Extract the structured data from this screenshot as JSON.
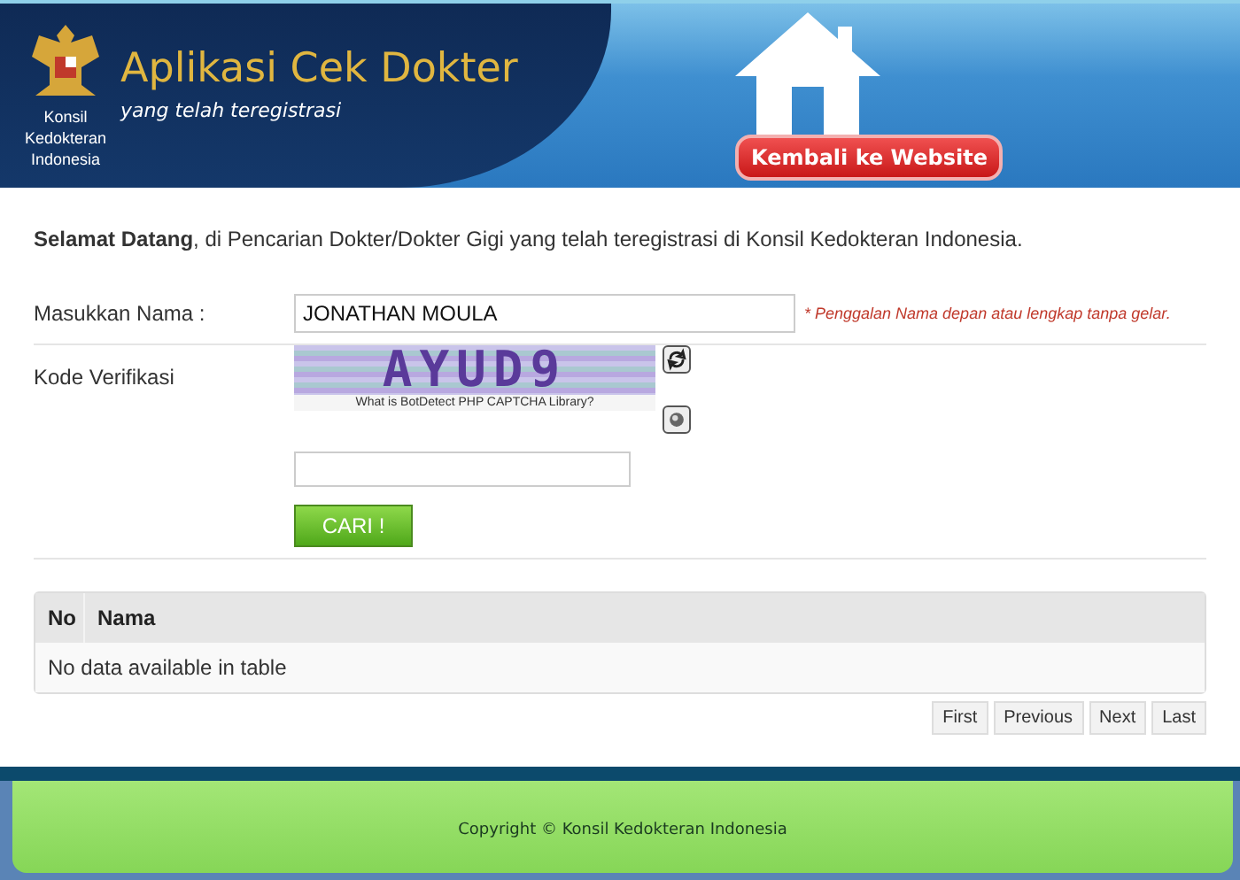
{
  "header": {
    "org_name": "Konsil Kedokteran Indonesia",
    "title": "Aplikasi Cek Dokter",
    "subtitle": "yang telah teregistrasi",
    "back_button": "Kembali ke Website"
  },
  "welcome": "**Selamat Datang**, di Pencarian Dokter/Dokter Gigi yang telah teregistrasi di Konsil Kedokteran Indonesia.",
  "form": {
    "name_label": "Masukkan Nama :",
    "name_value": "JONATHAN MOULA",
    "name_hint": "* Penggalan Nama depan atau lengkap tanpa gelar.",
    "captcha_label": "Kode Verifikasi",
    "captcha_code": "AYUD9",
    "captcha_link": "What is BotDetect PHP CAPTCHA Library?",
    "submit": "CARI !"
  },
  "table": {
    "columns": [
      "No",
      "Nama"
    ],
    "empty_message": "No data available in table"
  },
  "pagination": [
    "First",
    "Previous",
    "Next",
    "Last"
  ],
  "footer": "Copyright © Konsil Kedokteran Indonesia"
}
